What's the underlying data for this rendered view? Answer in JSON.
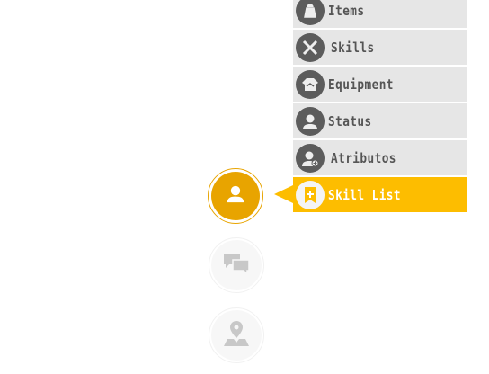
{
  "menu": {
    "items": [
      {
        "label": "Items",
        "icon": "bag-icon"
      },
      {
        "label": "Skills",
        "icon": "crossed-swords-icon"
      },
      {
        "label": "Equipment",
        "icon": "armor-icon"
      },
      {
        "label": "Status",
        "icon": "person-icon"
      },
      {
        "label": "Atributos",
        "icon": "person-plus-icon"
      },
      {
        "label": "Skill List",
        "icon": "bookmark-plus-icon",
        "active": true
      }
    ]
  },
  "side_buttons": [
    {
      "icon": "person-icon",
      "active": true
    },
    {
      "icon": "chat-icon",
      "active": false
    },
    {
      "icon": "map-pin-icon",
      "active": false
    }
  ],
  "colors": {
    "accent": "#fdbd00",
    "active_circle": "#e8a400",
    "menu_bg": "#e6e6e6",
    "icon_bg": "#5c5c5c",
    "text": "#555555"
  }
}
